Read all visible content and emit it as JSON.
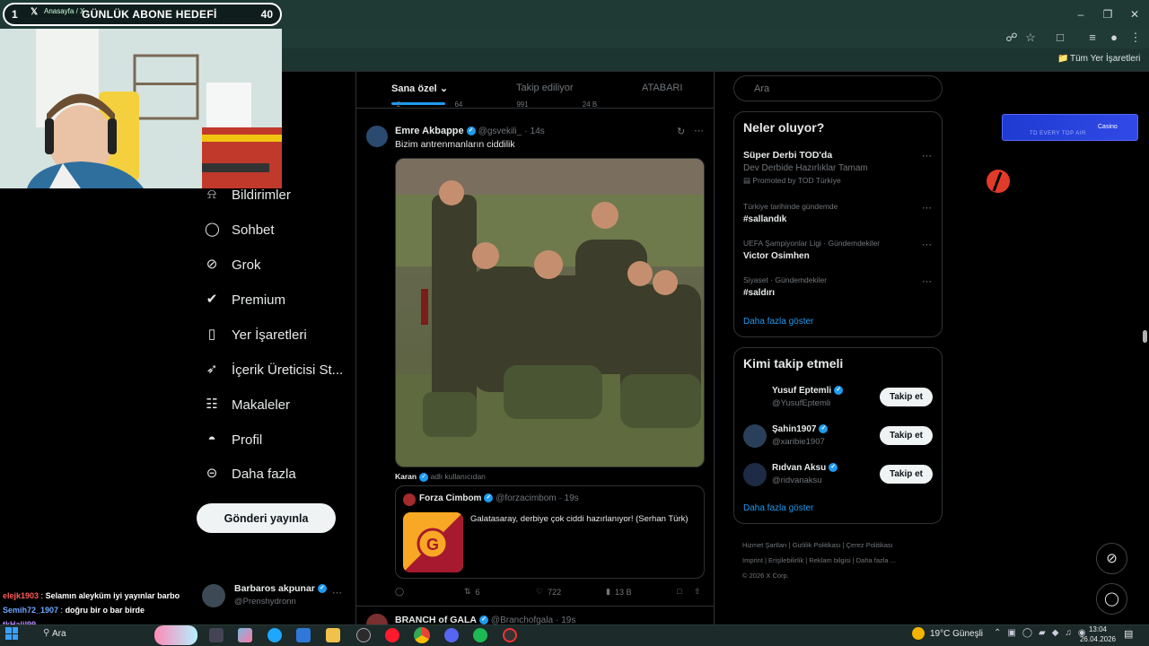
{
  "browser": {
    "tab_title": "Anasayfa / X",
    "bookmark_folder": "Tüm Yer İşaretleri"
  },
  "overlay": {
    "goal_index": "1",
    "goal_label": "GÜNLÜK ABONE HEDEFİ",
    "goal_count": "40"
  },
  "nav": {
    "items": [
      {
        "label": "Bildirimler",
        "icon": "bell-icon"
      },
      {
        "label": "Sohbet",
        "icon": "chat-icon"
      },
      {
        "label": "Grok",
        "icon": "grok-icon"
      },
      {
        "label": "Premium",
        "icon": "premium-icon"
      },
      {
        "label": "Yer İşaretleri",
        "icon": "bookmark-icon"
      },
      {
        "label": "İçerik Üreticisi St...",
        "icon": "rocket-icon"
      },
      {
        "label": "Makaleler",
        "icon": "articles-icon"
      },
      {
        "label": "Profil",
        "icon": "profile-icon"
      },
      {
        "label": "Daha fazla",
        "icon": "more-circle-icon"
      }
    ],
    "post_button": "Gönderi yayınla",
    "account_name": "Barbaros akpunar",
    "account_handle": "@Prenshydronn"
  },
  "feed": {
    "tabs": [
      "Sana özel",
      "Takip ediliyor",
      "ATABARI"
    ],
    "active_tab": "Sana özel",
    "prev_stats": {
      "replies": "2",
      "reposts": "64",
      "likes": "991",
      "views": "24 B"
    },
    "tweet": {
      "name": "Emre Akbappe",
      "handle": "@gsvekili_",
      "time": "14s",
      "text": "Bizim antrenmanların ciddilik",
      "retweeted_by": "Karan",
      "retweeted_suffix": "adlı kullanıcıdan"
    },
    "quote": {
      "name": "Forza Cimbom",
      "handle": "@forzacimbom",
      "time": "19s",
      "text": "Galatasaray, derbiye çok ciddi hazırlanıyor! (Serhan Türk)"
    },
    "actions": {
      "reposts": "6",
      "likes": "722",
      "views": "13 B"
    },
    "next_tweet": {
      "name": "BRANCH of GALA",
      "handle": "@Branchofgala",
      "time": "19s"
    }
  },
  "sidebar": {
    "search_placeholder": "Ara",
    "trends_title": "Neler oluyor?",
    "promo": {
      "title": "Süper Derbi TOD'da",
      "subtitle": "Dev Derbide Hazırlıklar Tamam",
      "promoted": "Promoted by TOD Türkiye"
    },
    "trends": [
      {
        "context": "Türkiye tarihinde gündemde",
        "title": "#sallandık"
      },
      {
        "context": "UEFA Şampiyonlar Ligi · Gündemdekiler",
        "title": "Victor Osimhen"
      },
      {
        "context": "Siyaset · Gündemdekiler",
        "title": "#saldırı"
      }
    ],
    "trends_more": "Daha fazla göster",
    "follow_title": "Kimi takip etmeli",
    "who": [
      {
        "name": "Yusuf Eptemli",
        "handle": "@YusufEptemli",
        "button": "Takip et"
      },
      {
        "name": "Şahin1907",
        "handle": "@xaribie1907",
        "button": "Takip et"
      },
      {
        "name": "Rıdvan Aksu",
        "handle": "@ridvanaksu",
        "button": "Takip et"
      }
    ],
    "who_more": "Daha fazla göster",
    "footer": [
      "Hizmet Şartları",
      "Gizlilik Politikası",
      "Çerez Politikası",
      "Imprint",
      "Erişilebilirlik",
      "Reklam bilgisi",
      "Daha fazla ...",
      "© 2026 X Corp."
    ]
  },
  "chat": [
    {
      "user": "elejk1903",
      "user_color": "#ff5a5a",
      "msg": "Selamın aleyküm iyi yayınlar barbo"
    },
    {
      "user": "Semih72_1907",
      "user_color": "#6fa8ff",
      "msg": "doğru bir o bar birde"
    },
    {
      "user": "tkHalil99",
      "user_color": "#b78bff",
      "msg": ""
    }
  ],
  "taskbar": {
    "search_label": "Ara",
    "weather": "19°C  Güneşli",
    "time": "13:04",
    "date": "26.04.2026"
  },
  "ad_label": "TD EVERY TOP AIR",
  "ad_brand": "Casino"
}
